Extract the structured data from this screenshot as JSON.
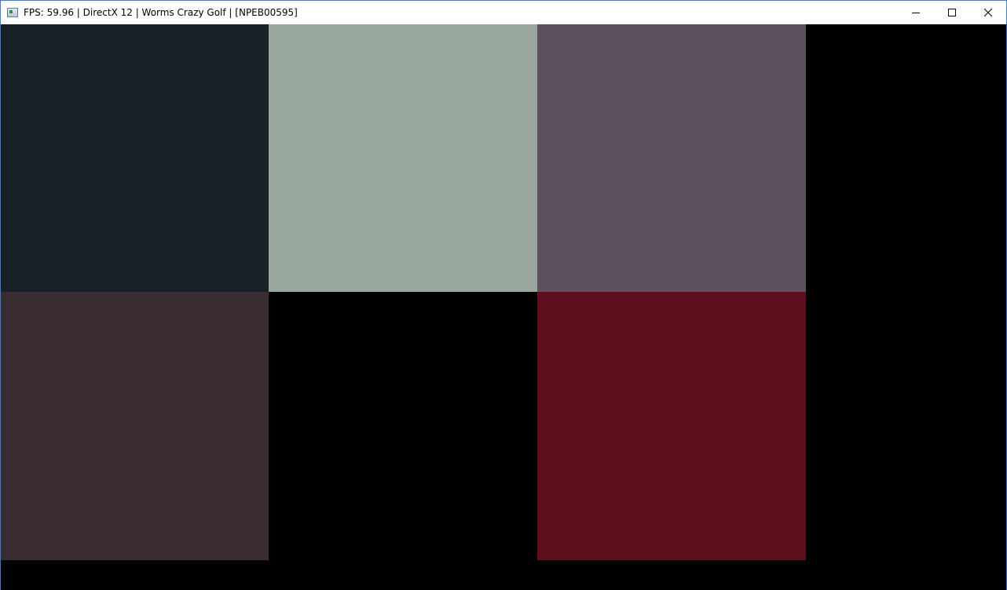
{
  "window": {
    "title": "FPS: 59.96 | DirectX 12 | Worms Crazy Golf | [NPEB00595]",
    "app_icon": "window-app-icon",
    "controls": {
      "minimize": "minimize-icon",
      "maximize": "maximize-icon",
      "close": "close-icon"
    }
  },
  "viewport": {
    "background": "#000000",
    "tiles": [
      {
        "id": "top-left",
        "color": "#182127"
      },
      {
        "id": "top-middle",
        "color": "#9aa79f"
      },
      {
        "id": "top-right",
        "color": "#5d515f"
      },
      {
        "id": "bottom-left",
        "color": "#392d33"
      },
      {
        "id": "bottom-middle",
        "color": "#000000"
      },
      {
        "id": "bottom-right",
        "color": "#600f1f"
      }
    ]
  }
}
